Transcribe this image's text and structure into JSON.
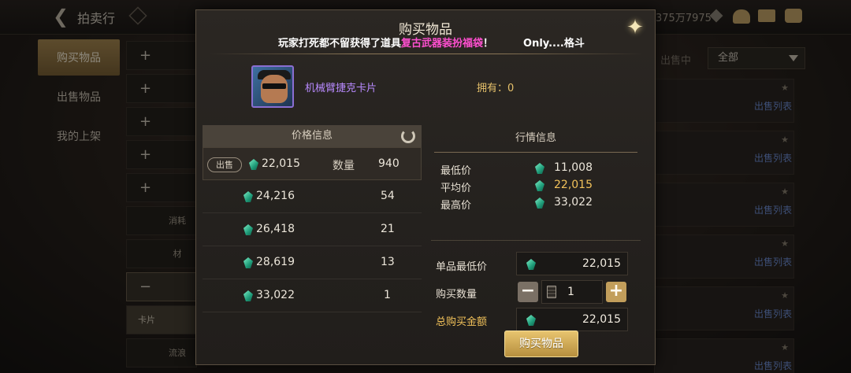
{
  "topbar": {
    "title": "拍卖行",
    "currency_amount": "375万7975"
  },
  "left_tabs": [
    {
      "label": "购买物品",
      "active": true
    },
    {
      "label": "出售物品",
      "active": false
    },
    {
      "label": "我的上架",
      "active": false
    }
  ],
  "category_list": [
    {
      "glyph": "+"
    },
    {
      "glyph": "+"
    },
    {
      "glyph": "+"
    },
    {
      "glyph": "+"
    },
    {
      "glyph": "+"
    },
    {
      "text": "消耗"
    },
    {
      "text": "材"
    },
    {
      "glyph": "−"
    },
    {
      "text": "卡片"
    },
    {
      "text": "流浪"
    }
  ],
  "right_filter": {
    "label": "出售中",
    "value": "全部"
  },
  "right_rows": [
    {
      "action": "出售列表"
    },
    {
      "action": "出售列表"
    },
    {
      "action": "出售列表"
    },
    {
      "action": "出售列表"
    },
    {
      "action": "出售列表"
    },
    {
      "action": "出售列表"
    }
  ],
  "modal": {
    "title": "购买物品",
    "marquee": {
      "prefix": "玩家打死都不留获得了道具",
      "highlight": "复古武器装扮福袋",
      "suffix": "！",
      "tail": "Only....格斗"
    },
    "item": {
      "name": "机械臂捷克卡片",
      "owned_label": "拥有：0"
    },
    "price_info": {
      "header": "价格信息",
      "sell_badge": "出售",
      "qty_label": "数量",
      "rows": [
        {
          "price": "22,015",
          "qty": "940"
        },
        {
          "price": "24,216",
          "qty": "54"
        },
        {
          "price": "26,418",
          "qty": "21"
        },
        {
          "price": "28,619",
          "qty": "13"
        },
        {
          "price": "33,022",
          "qty": "1"
        }
      ]
    },
    "market_info": {
      "header": "行情信息",
      "min_label": "最低价",
      "min_value": "11,008",
      "avg_label": "平均价",
      "avg_value": "22,015",
      "max_label": "最高价",
      "max_value": "33,022"
    },
    "purchase": {
      "unit_price_label": "单品最低价",
      "unit_price": "22,015",
      "qty_label": "购买数量",
      "qty": "1",
      "total_label": "总购买金额",
      "total": "22,015",
      "buy_button": "购买物品"
    }
  },
  "colors": {
    "gold_accent": "#f2c25a",
    "item_name_purple": "#b88aff",
    "highlight_pink": "#ff4fd0",
    "sell_list_blue": "#6f8fd6"
  }
}
